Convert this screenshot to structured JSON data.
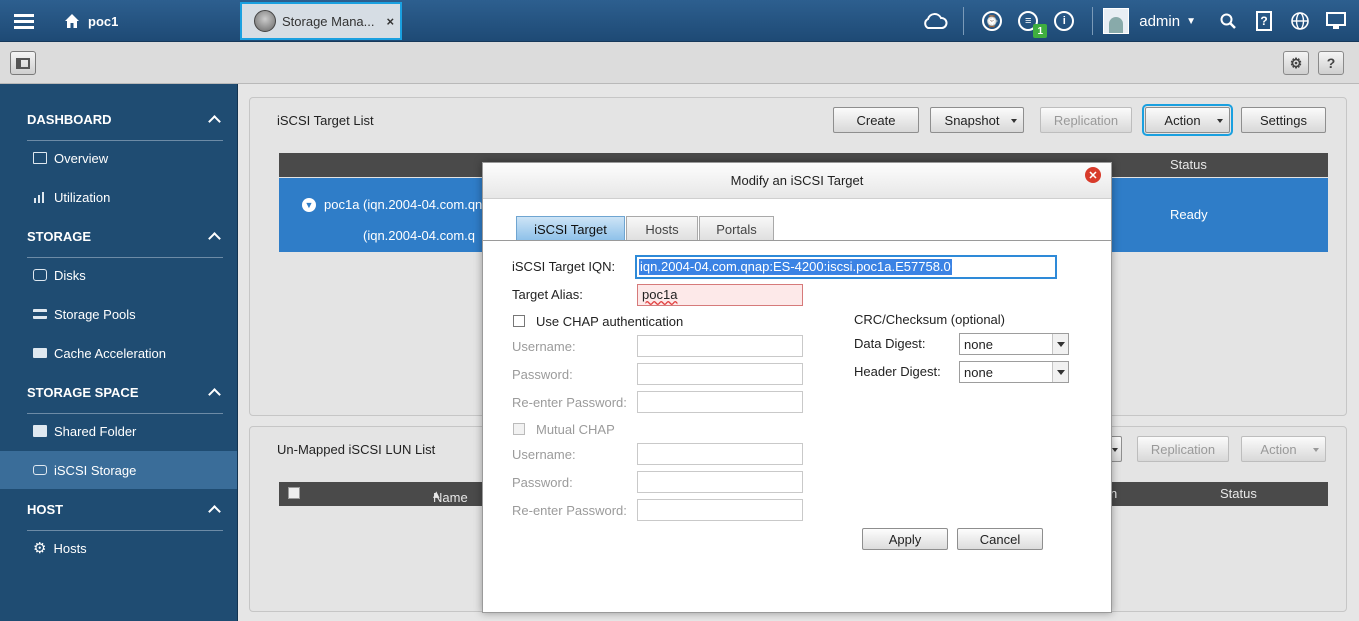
{
  "topbar": {
    "home_label": "poc1",
    "app_tab_label": "Storage Mana...",
    "app_tab_close": "×",
    "username": "admin",
    "notification_badge": "1"
  },
  "sidebar": {
    "sections": [
      {
        "title": "DASHBOARD",
        "items": [
          {
            "label": "Overview"
          },
          {
            "label": "Utilization"
          }
        ]
      },
      {
        "title": "STORAGE",
        "items": [
          {
            "label": "Disks"
          },
          {
            "label": "Storage Pools"
          },
          {
            "label": "Cache Acceleration"
          }
        ]
      },
      {
        "title": "STORAGE SPACE",
        "items": [
          {
            "label": "Shared Folder"
          },
          {
            "label": "iSCSI Storage"
          }
        ]
      },
      {
        "title": "HOST",
        "items": [
          {
            "label": "Hosts"
          }
        ]
      }
    ]
  },
  "target_panel": {
    "title": "iSCSI Target List",
    "buttons": {
      "create": "Create",
      "snapshot": "Snapshot",
      "replication": "Replication",
      "action": "Action",
      "settings": "Settings"
    },
    "columns": {
      "status": "Status"
    },
    "row": {
      "name_line1": "poc1a (iqn.2004-04.com.qn",
      "name_line2": "(iqn.2004-04.com.q",
      "status": "Ready"
    }
  },
  "lun_panel": {
    "title": "Un-Mapped iSCSI LUN List",
    "buttons": {
      "replication": "Replication",
      "action": "Action"
    },
    "columns": {
      "name": "Name",
      "status": "Status",
      "partial": "n"
    }
  },
  "modal": {
    "title": "Modify an iSCSI Target",
    "tabs": [
      "iSCSI Target",
      "Hosts",
      "Portals"
    ],
    "fields": {
      "iqn_label": "iSCSI Target IQN:",
      "iqn_value": "iqn.2004-04.com.qnap:ES-4200:iscsi.poc1a.E57758.0",
      "alias_label": "Target Alias:",
      "alias_value": "poc1a",
      "chap_label": "Use CHAP authentication",
      "username_label": "Username:",
      "password_label": "Password:",
      "reenter_label": "Re-enter Password:",
      "mutual_chap_label": "Mutual CHAP",
      "crc_label": "CRC/Checksum (optional)",
      "data_digest_label": "Data Digest:",
      "data_digest_value": "none",
      "header_digest_label": "Header Digest:",
      "header_digest_value": "none"
    },
    "buttons": {
      "apply": "Apply",
      "cancel": "Cancel"
    }
  }
}
